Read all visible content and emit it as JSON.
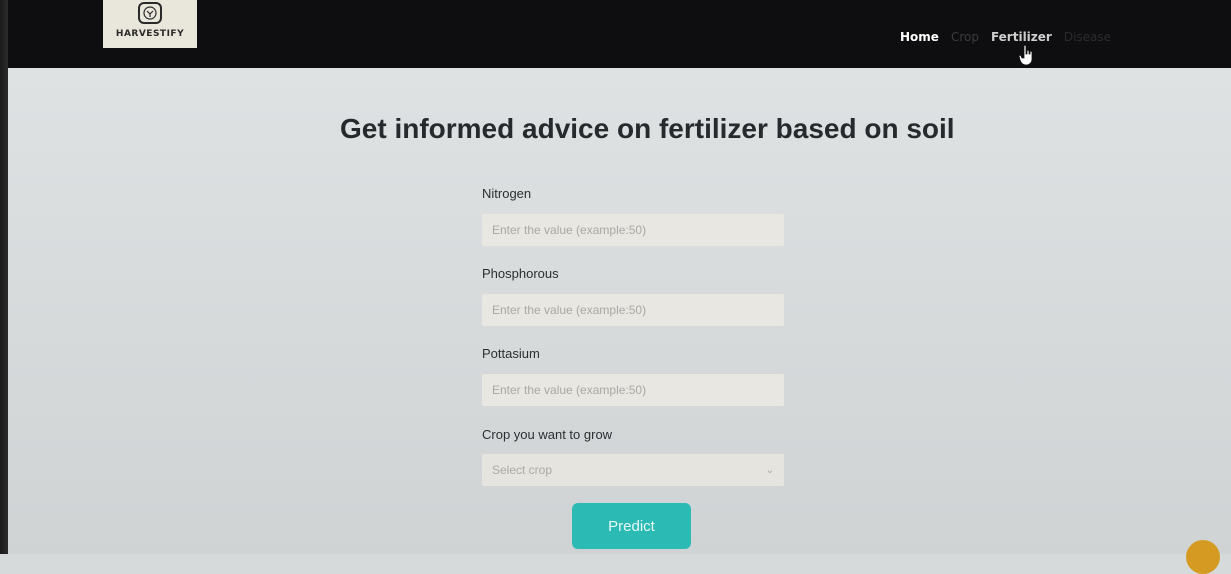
{
  "brand": {
    "name": "HARVESTIFY"
  },
  "nav": {
    "items": [
      {
        "label": "Home"
      },
      {
        "label": "Crop"
      },
      {
        "label": "Fertilizer"
      },
      {
        "label": "Disease"
      }
    ],
    "hovered": "Fertilizer"
  },
  "page": {
    "title": "Get informed advice on fertilizer based on soil"
  },
  "form": {
    "nitrogen": {
      "label": "Nitrogen",
      "placeholder": "Enter the value (example:50)",
      "value": ""
    },
    "phosphorous": {
      "label": "Phosphorous",
      "placeholder": "Enter the value (example:50)",
      "value": ""
    },
    "pottasium": {
      "label": "Pottasium",
      "placeholder": "Enter the value (example:50)",
      "value": ""
    },
    "crop": {
      "label": "Crop you want to grow",
      "selected": "Select crop"
    },
    "submit_label": "Predict"
  },
  "icons": {
    "logo": "leaf-badge-icon",
    "select_arrow": "chevron-down-icon",
    "pointer": "hand-cursor-icon"
  },
  "colors": {
    "navbar": "#0e0e10",
    "background": "#d7dadb",
    "input_bg": "#e9e7e1",
    "button": "#2bbbb4",
    "logo_bg": "#e9e6dc"
  }
}
